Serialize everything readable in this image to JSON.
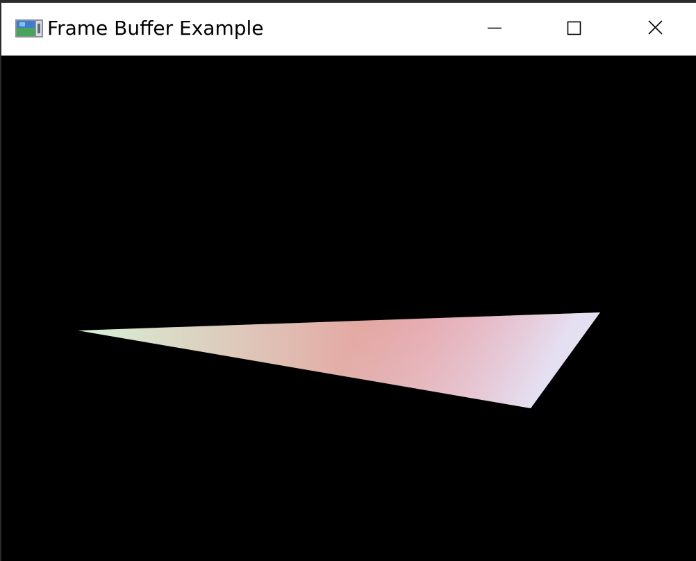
{
  "window": {
    "title": "Frame Buffer Example",
    "icon": "framebuffer-app-icon",
    "buttons": {
      "minimize_icon": "minimize-icon",
      "maximize_icon": "maximize-icon",
      "close_icon": "close-icon"
    }
  },
  "canvas": {
    "background": "#000000",
    "triangle": {
      "vertex_colors": {
        "left": "#d6f2d8",
        "right": "#ef6a76",
        "bottom": "#e4e6f8"
      }
    }
  }
}
